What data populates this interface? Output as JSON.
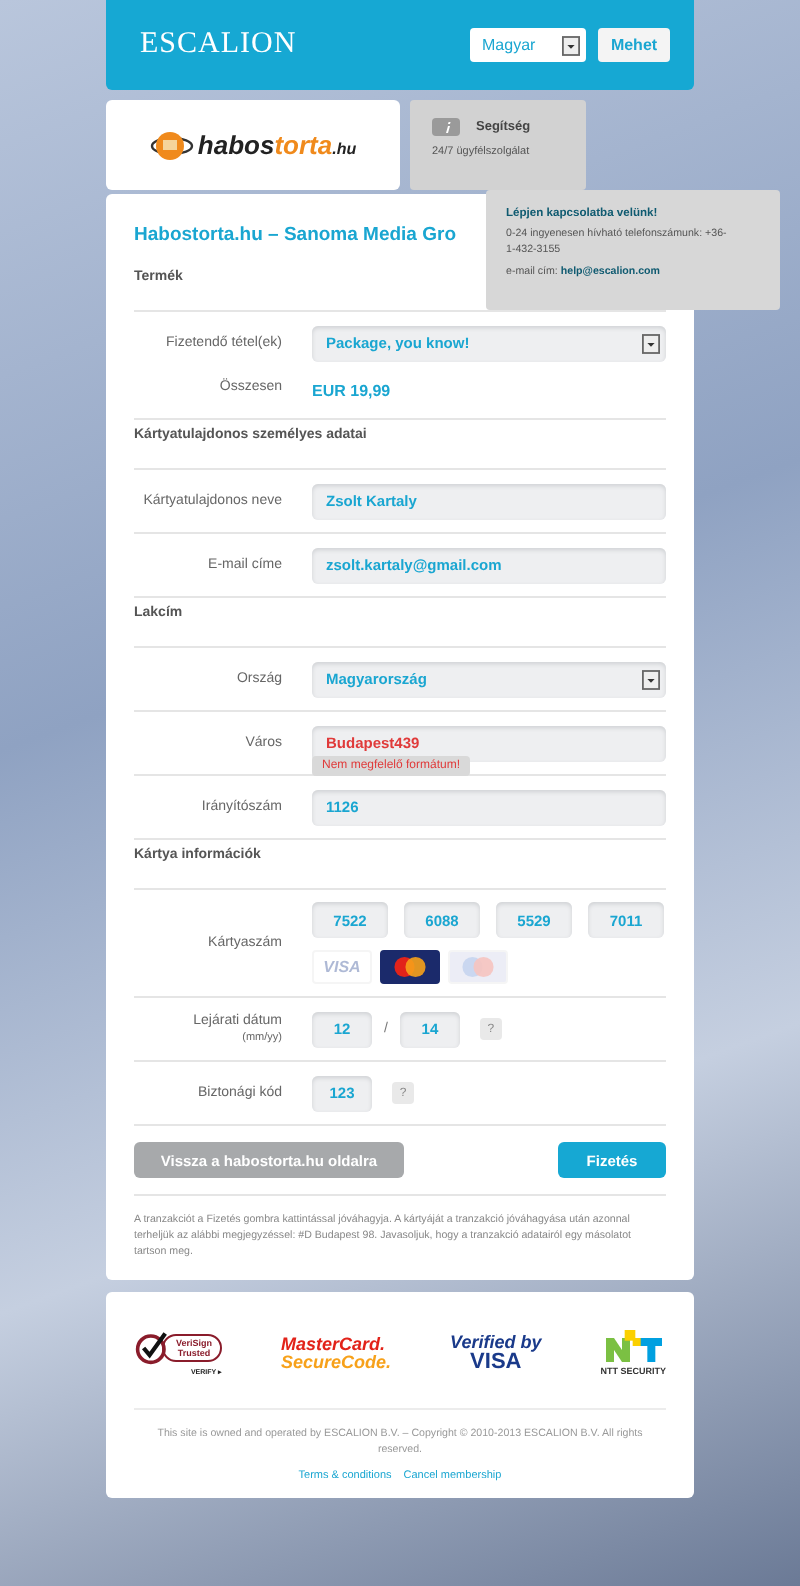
{
  "header": {
    "logo": "ESCALION",
    "language": "Magyar",
    "go_button": "Mehet"
  },
  "merchant": {
    "logo_parts": [
      "habos",
      "torta",
      ".hu"
    ]
  },
  "help": {
    "title": "Segítség",
    "subtitle": "24/7 ügyfélszolgálat"
  },
  "contact_popup": {
    "title": "Lépjen kapcsolatba velünk!",
    "phone_text": "0-24 ingyenesen hívható telefonszámunk: +36-1-432-3155",
    "email_label": "e-mail cím:",
    "email": "help@escalion.com"
  },
  "title": "Habostorta.hu – Sanoma Media Gro",
  "sections": [
    {
      "heading": "Termék",
      "rows": [
        {
          "kind": "select",
          "label": "Fizetendő tétel(ek)",
          "value": "Package, you know!"
        },
        {
          "kind": "amount",
          "label": "Összesen",
          "value": "EUR 19,99"
        }
      ]
    },
    {
      "heading": "Kártyatulajdonos személyes adatai",
      "rows": [
        {
          "kind": "text",
          "label": "Kártyatulajdonos neve",
          "value": "Zsolt Kartaly",
          "invalid": false
        },
        {
          "kind": "text",
          "label": "E-mail címe",
          "value": "zsolt.kartaly@gmail.com",
          "invalid": false
        }
      ]
    },
    {
      "heading": "Lakcím",
      "rows": [
        {
          "kind": "select",
          "label": "Ország",
          "value": "Magyarország"
        },
        {
          "kind": "text",
          "label": "Város",
          "value": "Budapest439",
          "invalid": true,
          "error": "Nem megfelelő formátum!"
        },
        {
          "kind": "text",
          "label": "Irányítószám",
          "value": "1126",
          "invalid": false
        }
      ]
    },
    {
      "heading": "Kártya információk",
      "rows": [
        {
          "kind": "card_number",
          "label": "Kártyaszám",
          "parts": [
            "7522",
            "6088",
            "5529",
            "7011"
          ],
          "card_types": [
            {
              "kind": "visa",
              "label": "VISA",
              "selected": false
            },
            {
              "kind": "mastercard",
              "selected": true
            },
            {
              "kind": "maestro",
              "selected": false
            }
          ]
        },
        {
          "kind": "expiry",
          "label": "Lejárati dátum",
          "sublabel": "(mm/yy)",
          "month": "12",
          "separator": "/",
          "year": "14",
          "help": "?"
        },
        {
          "kind": "cvc",
          "label": "Biztonági kód",
          "value": "123",
          "help": "?"
        }
      ]
    }
  ],
  "buttons": {
    "back": "Vissza a habostorta.hu oldalra",
    "pay": "Fizetés"
  },
  "disclaimer": "A tranzakciót a Fizetés gombra kattintással jóváhagyja. A kártyáját a tranzakció jóváhagyása után azonnal terheljük az alábbi megjegyzéssel: #D Budapest 98. Javasoljuk, hogy a tranzakció adatairól egy másolatot tartson meg.",
  "footer": {
    "badges": [
      {
        "kind": "verisign",
        "lines": [
          "VeriSign",
          "Trusted"
        ],
        "caption": "VERIFY ▸"
      },
      {
        "kind": "securecode",
        "lines": [
          "MasterCard.",
          "SecureCode."
        ]
      },
      {
        "kind": "verified",
        "lines": [
          "Verified by",
          "VISA"
        ]
      },
      {
        "kind": "ntt",
        "caption": "NTT SECURITY"
      }
    ],
    "copyright": "This site is owned and operated by ESCALION B.V. – Copyright © 2010-2013 ESCALION B.V. All rights reserved.",
    "links": [
      "Terms & conditions",
      "Cancel membership"
    ]
  }
}
